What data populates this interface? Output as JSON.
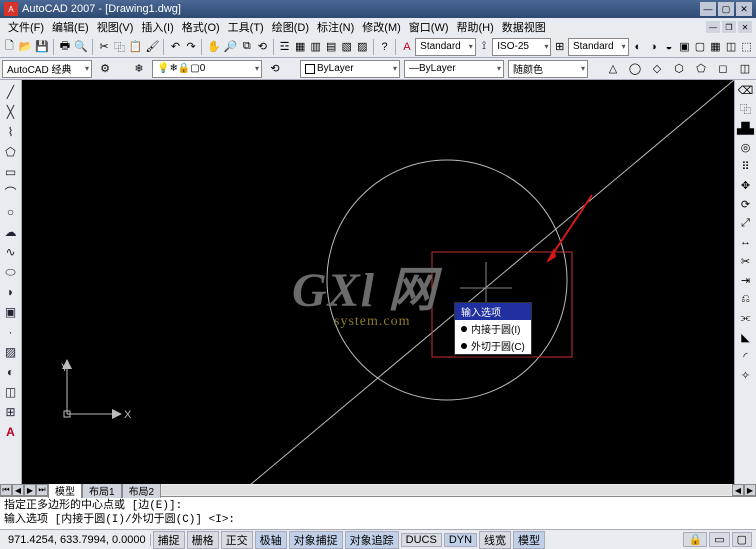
{
  "app_title": "AutoCAD 2007 - [Drawing1.dwg]",
  "menu": {
    "items": [
      "文件(F)",
      "编辑(E)",
      "视图(V)",
      "插入(I)",
      "格式(O)",
      "工具(T)",
      "绘图(D)",
      "标注(N)",
      "修改(M)",
      "窗口(W)",
      "帮助(H)",
      "数据视图"
    ]
  },
  "workspace": {
    "label": "AutoCAD 经典"
  },
  "style_combo1": "Standard",
  "style_combo2": "ISO-25",
  "style_combo3": "Standard",
  "style_combo4": "Standard",
  "layer_combo": "0",
  "linetype_combo": "ByLayer",
  "lineweight_combo": "ByLayer",
  "color_combo": "随颜色",
  "tabs": {
    "t0": "模型",
    "t1": "布局1",
    "t2": "布局2"
  },
  "command": {
    "line1": "指定正多边形的中心点或 [边(E)]:",
    "line2": "输入选项 [内接于圆(I)/外切于圆(C)] <I>:"
  },
  "status": {
    "coords": "971.4254, 633.7994, 0.0000",
    "snap": "捕捉",
    "grid": "栅格",
    "ortho": "正交",
    "polar": "极轴",
    "osnap": "对象捕捉",
    "otrack": "对象追踪",
    "ducs": "DUCS",
    "dyn": "DYN",
    "lwt": "线宽",
    "model": "模型"
  },
  "context": {
    "title": "输入选项",
    "item1": "内接于圆(I)",
    "item2": "外切于圆(C)"
  },
  "ucs": {
    "x": "X",
    "y": "Y"
  },
  "watermark": {
    "big": "GXl 网",
    "sub": "system.com"
  }
}
